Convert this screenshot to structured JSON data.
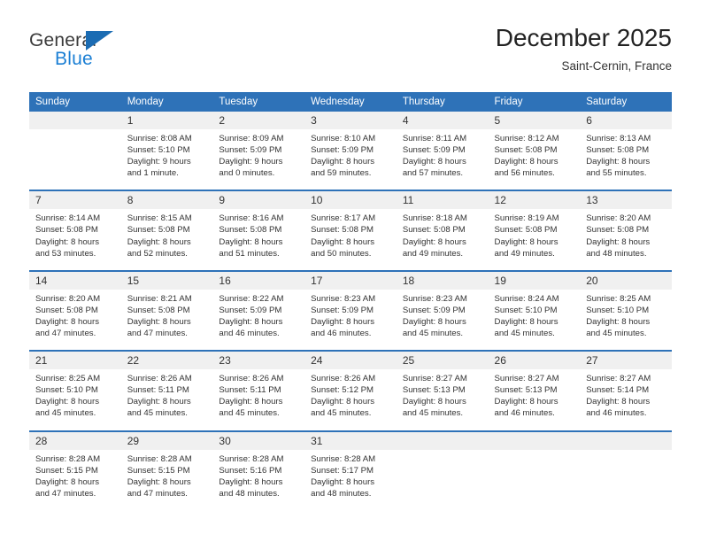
{
  "logo": {
    "word_one": "General",
    "word_two": "Blue",
    "triangle_color": "#1b6cb3",
    "blue_text_color": "#1b7fd4"
  },
  "header": {
    "title": "December 2025",
    "subtitle": "Saint-Cernin, France"
  },
  "colors": {
    "header_row_background": "#2e72b8",
    "header_row_text": "#ffffff",
    "daynumber_band": "#f0f0f0",
    "week_separator": "#2e72b8",
    "body_text": "#333333"
  },
  "calendar": {
    "weekday_headers": [
      "Sunday",
      "Monday",
      "Tuesday",
      "Wednesday",
      "Thursday",
      "Friday",
      "Saturday"
    ],
    "weeks": [
      [
        {
          "day": "",
          "lines": []
        },
        {
          "day": "1",
          "lines": [
            "Sunrise: 8:08 AM",
            "Sunset: 5:10 PM",
            "Daylight: 9 hours",
            "and 1 minute."
          ]
        },
        {
          "day": "2",
          "lines": [
            "Sunrise: 8:09 AM",
            "Sunset: 5:09 PM",
            "Daylight: 9 hours",
            "and 0 minutes."
          ]
        },
        {
          "day": "3",
          "lines": [
            "Sunrise: 8:10 AM",
            "Sunset: 5:09 PM",
            "Daylight: 8 hours",
            "and 59 minutes."
          ]
        },
        {
          "day": "4",
          "lines": [
            "Sunrise: 8:11 AM",
            "Sunset: 5:09 PM",
            "Daylight: 8 hours",
            "and 57 minutes."
          ]
        },
        {
          "day": "5",
          "lines": [
            "Sunrise: 8:12 AM",
            "Sunset: 5:08 PM",
            "Daylight: 8 hours",
            "and 56 minutes."
          ]
        },
        {
          "day": "6",
          "lines": [
            "Sunrise: 8:13 AM",
            "Sunset: 5:08 PM",
            "Daylight: 8 hours",
            "and 55 minutes."
          ]
        }
      ],
      [
        {
          "day": "7",
          "lines": [
            "Sunrise: 8:14 AM",
            "Sunset: 5:08 PM",
            "Daylight: 8 hours",
            "and 53 minutes."
          ]
        },
        {
          "day": "8",
          "lines": [
            "Sunrise: 8:15 AM",
            "Sunset: 5:08 PM",
            "Daylight: 8 hours",
            "and 52 minutes."
          ]
        },
        {
          "day": "9",
          "lines": [
            "Sunrise: 8:16 AM",
            "Sunset: 5:08 PM",
            "Daylight: 8 hours",
            "and 51 minutes."
          ]
        },
        {
          "day": "10",
          "lines": [
            "Sunrise: 8:17 AM",
            "Sunset: 5:08 PM",
            "Daylight: 8 hours",
            "and 50 minutes."
          ]
        },
        {
          "day": "11",
          "lines": [
            "Sunrise: 8:18 AM",
            "Sunset: 5:08 PM",
            "Daylight: 8 hours",
            "and 49 minutes."
          ]
        },
        {
          "day": "12",
          "lines": [
            "Sunrise: 8:19 AM",
            "Sunset: 5:08 PM",
            "Daylight: 8 hours",
            "and 49 minutes."
          ]
        },
        {
          "day": "13",
          "lines": [
            "Sunrise: 8:20 AM",
            "Sunset: 5:08 PM",
            "Daylight: 8 hours",
            "and 48 minutes."
          ]
        }
      ],
      [
        {
          "day": "14",
          "lines": [
            "Sunrise: 8:20 AM",
            "Sunset: 5:08 PM",
            "Daylight: 8 hours",
            "and 47 minutes."
          ]
        },
        {
          "day": "15",
          "lines": [
            "Sunrise: 8:21 AM",
            "Sunset: 5:08 PM",
            "Daylight: 8 hours",
            "and 47 minutes."
          ]
        },
        {
          "day": "16",
          "lines": [
            "Sunrise: 8:22 AM",
            "Sunset: 5:09 PM",
            "Daylight: 8 hours",
            "and 46 minutes."
          ]
        },
        {
          "day": "17",
          "lines": [
            "Sunrise: 8:23 AM",
            "Sunset: 5:09 PM",
            "Daylight: 8 hours",
            "and 46 minutes."
          ]
        },
        {
          "day": "18",
          "lines": [
            "Sunrise: 8:23 AM",
            "Sunset: 5:09 PM",
            "Daylight: 8 hours",
            "and 45 minutes."
          ]
        },
        {
          "day": "19",
          "lines": [
            "Sunrise: 8:24 AM",
            "Sunset: 5:10 PM",
            "Daylight: 8 hours",
            "and 45 minutes."
          ]
        },
        {
          "day": "20",
          "lines": [
            "Sunrise: 8:25 AM",
            "Sunset: 5:10 PM",
            "Daylight: 8 hours",
            "and 45 minutes."
          ]
        }
      ],
      [
        {
          "day": "21",
          "lines": [
            "Sunrise: 8:25 AM",
            "Sunset: 5:10 PM",
            "Daylight: 8 hours",
            "and 45 minutes."
          ]
        },
        {
          "day": "22",
          "lines": [
            "Sunrise: 8:26 AM",
            "Sunset: 5:11 PM",
            "Daylight: 8 hours",
            "and 45 minutes."
          ]
        },
        {
          "day": "23",
          "lines": [
            "Sunrise: 8:26 AM",
            "Sunset: 5:11 PM",
            "Daylight: 8 hours",
            "and 45 minutes."
          ]
        },
        {
          "day": "24",
          "lines": [
            "Sunrise: 8:26 AM",
            "Sunset: 5:12 PM",
            "Daylight: 8 hours",
            "and 45 minutes."
          ]
        },
        {
          "day": "25",
          "lines": [
            "Sunrise: 8:27 AM",
            "Sunset: 5:13 PM",
            "Daylight: 8 hours",
            "and 45 minutes."
          ]
        },
        {
          "day": "26",
          "lines": [
            "Sunrise: 8:27 AM",
            "Sunset: 5:13 PM",
            "Daylight: 8 hours",
            "and 46 minutes."
          ]
        },
        {
          "day": "27",
          "lines": [
            "Sunrise: 8:27 AM",
            "Sunset: 5:14 PM",
            "Daylight: 8 hours",
            "and 46 minutes."
          ]
        }
      ],
      [
        {
          "day": "28",
          "lines": [
            "Sunrise: 8:28 AM",
            "Sunset: 5:15 PM",
            "Daylight: 8 hours",
            "and 47 minutes."
          ]
        },
        {
          "day": "29",
          "lines": [
            "Sunrise: 8:28 AM",
            "Sunset: 5:15 PM",
            "Daylight: 8 hours",
            "and 47 minutes."
          ]
        },
        {
          "day": "30",
          "lines": [
            "Sunrise: 8:28 AM",
            "Sunset: 5:16 PM",
            "Daylight: 8 hours",
            "and 48 minutes."
          ]
        },
        {
          "day": "31",
          "lines": [
            "Sunrise: 8:28 AM",
            "Sunset: 5:17 PM",
            "Daylight: 8 hours",
            "and 48 minutes."
          ]
        },
        {
          "day": "",
          "lines": []
        },
        {
          "day": "",
          "lines": []
        },
        {
          "day": "",
          "lines": []
        }
      ]
    ]
  }
}
